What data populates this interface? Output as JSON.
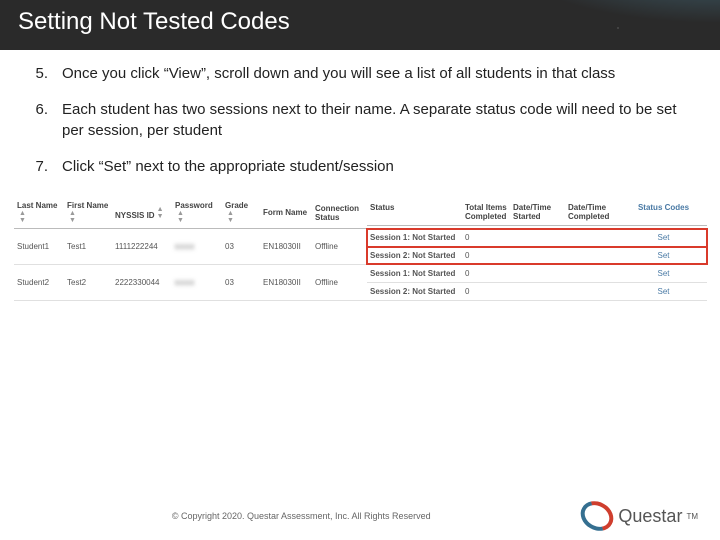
{
  "title": "Setting Not Tested Codes",
  "steps": [
    {
      "num": "5.",
      "text": "Once you click “View”, scroll down and you will see a list of all students in that class"
    },
    {
      "num": "6.",
      "text": "Each student has two sessions next to their name. A separate status code will need to be set per session, per student"
    },
    {
      "num": "7.",
      "text": "Click “Set” next to the appropriate student/session"
    }
  ],
  "table": {
    "headers": {
      "last": "Last Name",
      "first": "First Name",
      "nyssis": "NYSSIS ID",
      "password": "Password",
      "grade": "Grade",
      "form": "Form Name",
      "conn": "Connection Status",
      "status": "Status",
      "items": "Total Items Completed",
      "started": "Date/Time Started",
      "completed": "Date/Time Completed",
      "codes": "Status Codes"
    },
    "rows": [
      {
        "last": "Student1",
        "first": "Test1",
        "nyssis": "1111222244",
        "password": "xxxx",
        "grade": "03",
        "form": "EN18030II",
        "conn": "Offline",
        "sessions": [
          {
            "status": "Session 1: Not Started",
            "items": "0",
            "started": "",
            "completed": "",
            "codes": "Set",
            "highlight": true
          },
          {
            "status": "Session 2: Not Started",
            "items": "0",
            "started": "",
            "completed": "",
            "codes": "Set",
            "highlight": true
          }
        ]
      },
      {
        "last": "Student2",
        "first": "Test2",
        "nyssis": "2222330044",
        "password": "xxxx",
        "grade": "03",
        "form": "EN18030II",
        "conn": "Offline",
        "sessions": [
          {
            "status": "Session 1: Not Started",
            "items": "0",
            "started": "",
            "completed": "",
            "codes": "Set",
            "highlight": false
          },
          {
            "status": "Session 2: Not Started",
            "items": "0",
            "started": "",
            "completed": "",
            "codes": "Set",
            "highlight": false
          }
        ]
      }
    ]
  },
  "footer": {
    "copyright": "© Copyright 2020. Questar Assessment, Inc. All Rights Reserved",
    "logo_text": "Questar",
    "logo_tm": "TM"
  }
}
